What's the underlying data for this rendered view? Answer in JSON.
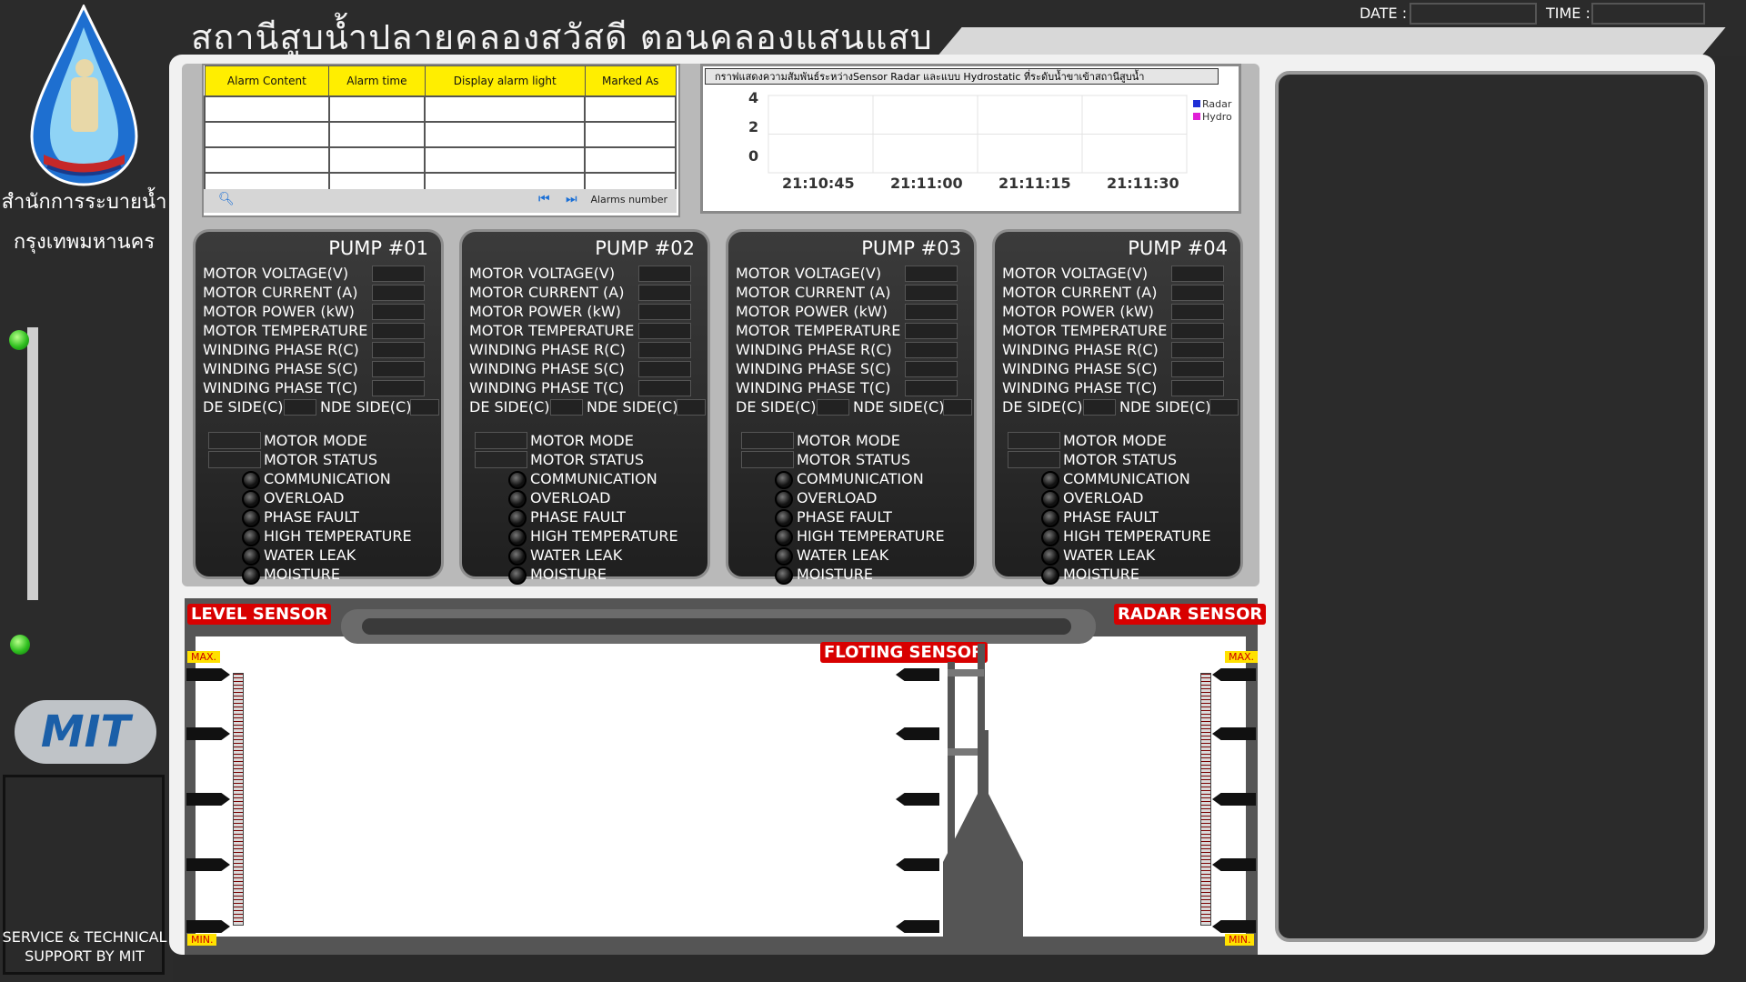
{
  "header": {
    "title": "สถานีสูบน้ำปลายคลองสวัสดี ตอนคลองแสนแสบ",
    "date_label": "DATE :",
    "time_label": "TIME :"
  },
  "sidebar": {
    "org_line1": "สำนักการระบายน้ำ",
    "org_line2": "กรุงเทพมหานคร",
    "mit_logo_text": "MIT",
    "service_line1": "SERVICE & TECHNICAL",
    "service_line2": "SUPPORT BY MIT"
  },
  "alarm_table": {
    "columns": [
      "Alarm Content",
      "Alarm time",
      "Display alarm light",
      "Marked As"
    ],
    "rows": [
      [
        "",
        "",
        "",
        ""
      ],
      [
        "",
        "",
        "",
        ""
      ],
      [
        "",
        "",
        "",
        ""
      ],
      [
        "",
        "",
        "",
        ""
      ]
    ],
    "footer_label": "Alarms number"
  },
  "trend": {
    "title": "กราฟแสดงความสัมพันธ์ระหว่างSensor Radar และแบบ Hydrostatic ที่ระดับน้ำขาเข้าสถานีสูบน้ำ",
    "legend": [
      {
        "name": "Radar",
        "color": "#1f2fd6"
      },
      {
        "name": "Hydro",
        "color": "#e01fd6"
      }
    ],
    "y_ticks": [
      "4",
      "2",
      "0"
    ],
    "x_ticks": [
      "21:10:45",
      "21:11:00",
      "21:11:15",
      "21:11:30"
    ]
  },
  "pump_labels": {
    "voltage": "MOTOR  VOLTAGE(V)",
    "current": "MOTOR CURRENT (A)",
    "power": "MOTOR POWER (kW)",
    "temperature": "MOTOR TEMPERATURE",
    "phase_r": "WINDING PHASE R(C)",
    "phase_s": "WINDING PHASE S(C)",
    "phase_t": "WINDING PHASE T(C)",
    "de_side": "DE SIDE(C)",
    "nde_side": "NDE SIDE(C)",
    "mode": "MOTOR MODE",
    "status": "MOTOR STATUS",
    "communication": "COMMUNICATION",
    "overload": "OVERLOAD",
    "phase_fault": "PHASE FAULT",
    "high_temp": "HIGH TEMPERATURE",
    "water_leak": "WATER LEAK",
    "moisture": "MOISTURE"
  },
  "pumps": [
    {
      "title": "PUMP #01"
    },
    {
      "title": "PUMP #02"
    },
    {
      "title": "PUMP #03"
    },
    {
      "title": "PUMP #04"
    }
  ],
  "sensors": {
    "level": "LEVEL SENSOR",
    "radar": "RADAR SENSOR",
    "floating": "FLOTING SENSOR",
    "max": "MAX.",
    "min": "MIN."
  }
}
